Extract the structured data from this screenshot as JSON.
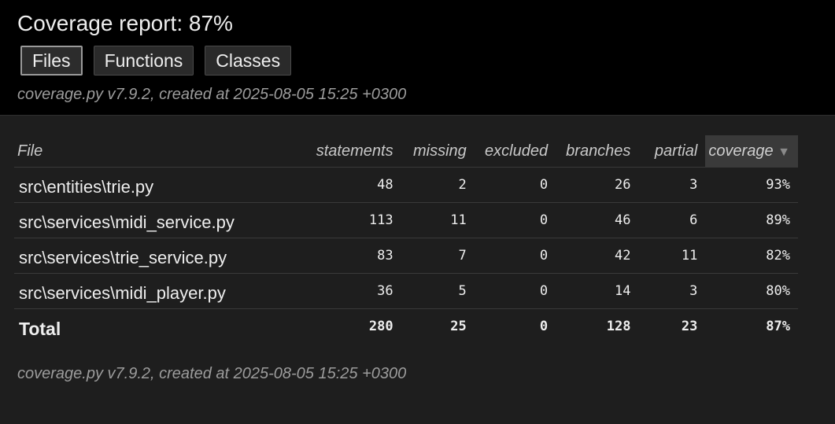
{
  "header": {
    "title": "Coverage report: 87%",
    "tabs": [
      {
        "label": "Files",
        "active": true
      },
      {
        "label": "Functions",
        "active": false
      },
      {
        "label": "Classes",
        "active": false
      }
    ],
    "created": "coverage.py v7.9.2, created at 2025-08-05 15:25 +0300"
  },
  "table": {
    "columns": [
      "File",
      "statements",
      "missing",
      "excluded",
      "branches",
      "partial",
      "coverage"
    ],
    "sort_indicator": "▼",
    "rows": [
      {
        "file": "src\\entities\\trie.py",
        "statements": "48",
        "missing": "2",
        "excluded": "0",
        "branches": "26",
        "partial": "3",
        "coverage": "93%"
      },
      {
        "file": "src\\services\\midi_service.py",
        "statements": "113",
        "missing": "11",
        "excluded": "0",
        "branches": "46",
        "partial": "6",
        "coverage": "89%"
      },
      {
        "file": "src\\services\\trie_service.py",
        "statements": "83",
        "missing": "7",
        "excluded": "0",
        "branches": "42",
        "partial": "11",
        "coverage": "82%"
      },
      {
        "file": "src\\services\\midi_player.py",
        "statements": "36",
        "missing": "5",
        "excluded": "0",
        "branches": "14",
        "partial": "3",
        "coverage": "80%"
      }
    ],
    "total": {
      "file": "Total",
      "statements": "280",
      "missing": "25",
      "excluded": "0",
      "branches": "128",
      "partial": "23",
      "coverage": "87%"
    }
  },
  "footer": {
    "created": "coverage.py v7.9.2, created at 2025-08-05 15:25 +0300"
  }
}
